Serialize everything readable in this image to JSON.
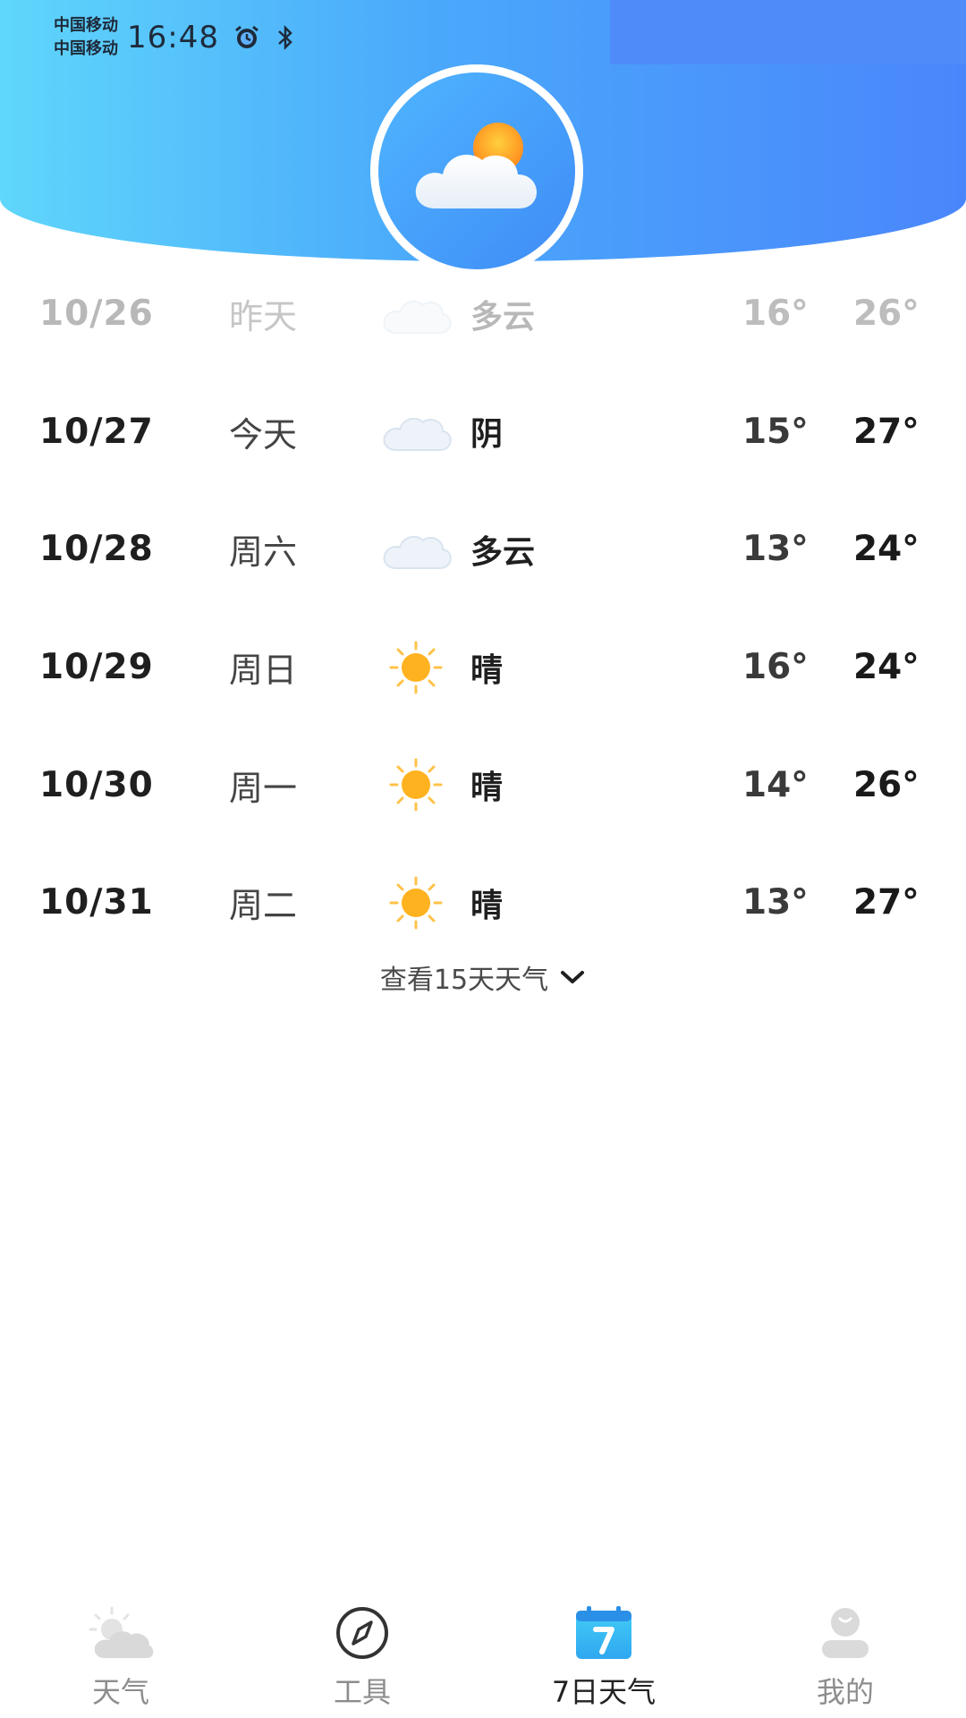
{
  "status_bar": {
    "carrier_1": "中国移动",
    "carrier_2": "中国移动",
    "time": "16:48",
    "icons": [
      "alarm-icon",
      "bluetooth-icon"
    ]
  },
  "header": {
    "logo_icon": "cloud-sun-icon",
    "gradient_colors": [
      "#5fd6fb",
      "#4a86fb"
    ]
  },
  "forecast": [
    {
      "date": "10/26",
      "day": "昨天",
      "icon": "cloud-icon",
      "condition": "多云",
      "low": "16°",
      "high": "26°",
      "past": true
    },
    {
      "date": "10/27",
      "day": "今天",
      "icon": "cloud-icon",
      "condition": "阴",
      "low": "15°",
      "high": "27°",
      "past": false
    },
    {
      "date": "10/28",
      "day": "周六",
      "icon": "cloud-icon",
      "condition": "多云",
      "low": "13°",
      "high": "24°",
      "past": false
    },
    {
      "date": "10/29",
      "day": "周日",
      "icon": "sun-icon",
      "condition": "晴",
      "low": "16°",
      "high": "24°",
      "past": false
    },
    {
      "date": "10/30",
      "day": "周一",
      "icon": "sun-icon",
      "condition": "晴",
      "low": "14°",
      "high": "26°",
      "past": false
    },
    {
      "date": "10/31",
      "day": "周二",
      "icon": "sun-icon",
      "condition": "晴",
      "low": "13°",
      "high": "27°",
      "past": false
    }
  ],
  "more_link": {
    "label": "查看15天天气"
  },
  "bottom_nav": [
    {
      "label": "天气",
      "icon": "weather-icon",
      "active": false
    },
    {
      "label": "工具",
      "icon": "compass-icon",
      "active": false
    },
    {
      "label": "7日天气",
      "icon": "calendar-7-icon",
      "active": true
    },
    {
      "label": "我的",
      "icon": "profile-icon",
      "active": false
    }
  ],
  "colors": {
    "accent": "#4a86fb",
    "sun": "#ffb21f",
    "text_primary": "#1f1f1f",
    "text_muted": "#b8b8b8"
  }
}
